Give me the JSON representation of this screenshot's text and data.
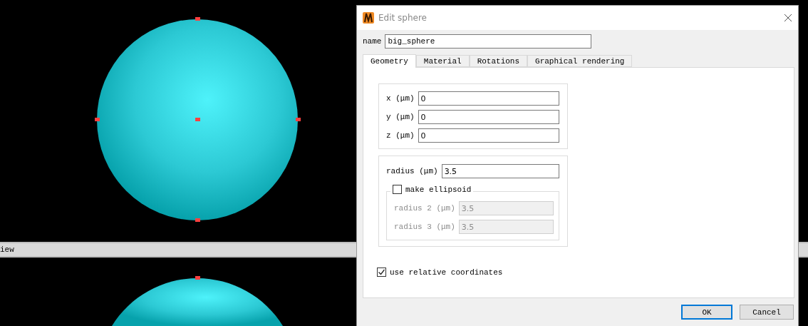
{
  "viewport_bar": {
    "label": "iew"
  },
  "dialog": {
    "title": "Edit sphere",
    "name": {
      "label": "name",
      "value": "big_sphere"
    },
    "tabs": [
      {
        "label": "Geometry",
        "selected": true
      },
      {
        "label": "Material",
        "selected": false
      },
      {
        "label": "Rotations",
        "selected": false
      },
      {
        "label": "Graphical rendering",
        "selected": false
      }
    ],
    "position_fields": [
      {
        "label": "x (μm)",
        "value": "0"
      },
      {
        "label": "y (μm)",
        "value": "0"
      },
      {
        "label": "z (μm)",
        "value": "0"
      }
    ],
    "radius": {
      "label": "radius (μm)",
      "value": "3.5"
    },
    "ellipsoid": {
      "label": "make ellipsoid",
      "checked": false,
      "fields": [
        {
          "label": "radius 2 (μm)",
          "value": "3.5"
        },
        {
          "label": "radius 3 (μm)",
          "value": "3.5"
        }
      ]
    },
    "relative_coordinates": {
      "label": "use relative coordinates",
      "checked": true
    },
    "buttons": [
      {
        "label": "OK",
        "default": true
      },
      {
        "label": "Cancel",
        "default": false
      }
    ]
  }
}
